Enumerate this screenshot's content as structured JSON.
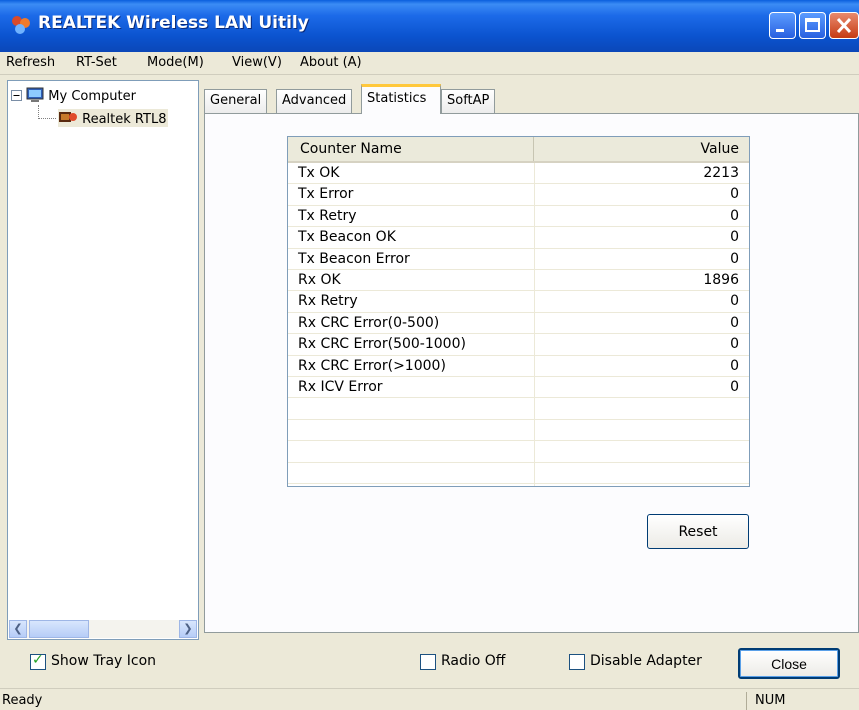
{
  "window": {
    "title": "REALTEK Wireless LAN Uitily"
  },
  "menu": [
    "Refresh",
    "RT-Set",
    "Mode(M)",
    "View(V)",
    "About (A)"
  ],
  "tree": {
    "root_label": "My Computer",
    "child_label": "Realtek RTL8"
  },
  "tabs": [
    "General",
    "Advanced",
    "Statistics",
    "SoftAP"
  ],
  "active_tab": "Statistics",
  "statistics": {
    "columns": {
      "name": "Counter Name",
      "value": "Value"
    },
    "rows": [
      {
        "name": "Tx OK",
        "value": "2213"
      },
      {
        "name": "Tx Error",
        "value": "0"
      },
      {
        "name": "Tx Retry",
        "value": "0"
      },
      {
        "name": "Tx Beacon OK",
        "value": "0"
      },
      {
        "name": "Tx Beacon Error",
        "value": "0"
      },
      {
        "name": "Rx OK",
        "value": "1896"
      },
      {
        "name": "Rx Retry",
        "value": "0"
      },
      {
        "name": "Rx CRC Error(0-500)",
        "value": "0"
      },
      {
        "name": "Rx CRC Error(500-1000)",
        "value": "0"
      },
      {
        "name": "Rx CRC Error(>1000)",
        "value": "0"
      },
      {
        "name": "Rx ICV Error",
        "value": "0"
      }
    ],
    "reset_label": "Reset"
  },
  "options": {
    "show_tray_icon": {
      "label": "Show Tray Icon",
      "checked": true
    },
    "radio_off": {
      "label": "Radio Off",
      "checked": false
    },
    "disable_adapter": {
      "label": "Disable Adapter",
      "checked": false
    }
  },
  "close_label": "Close",
  "status": {
    "text": "Ready",
    "num": "NUM"
  },
  "colors": {
    "titlebar": "#0b53cf",
    "close_button": "#c63b13",
    "tab_highlight": "#ffc83c"
  }
}
